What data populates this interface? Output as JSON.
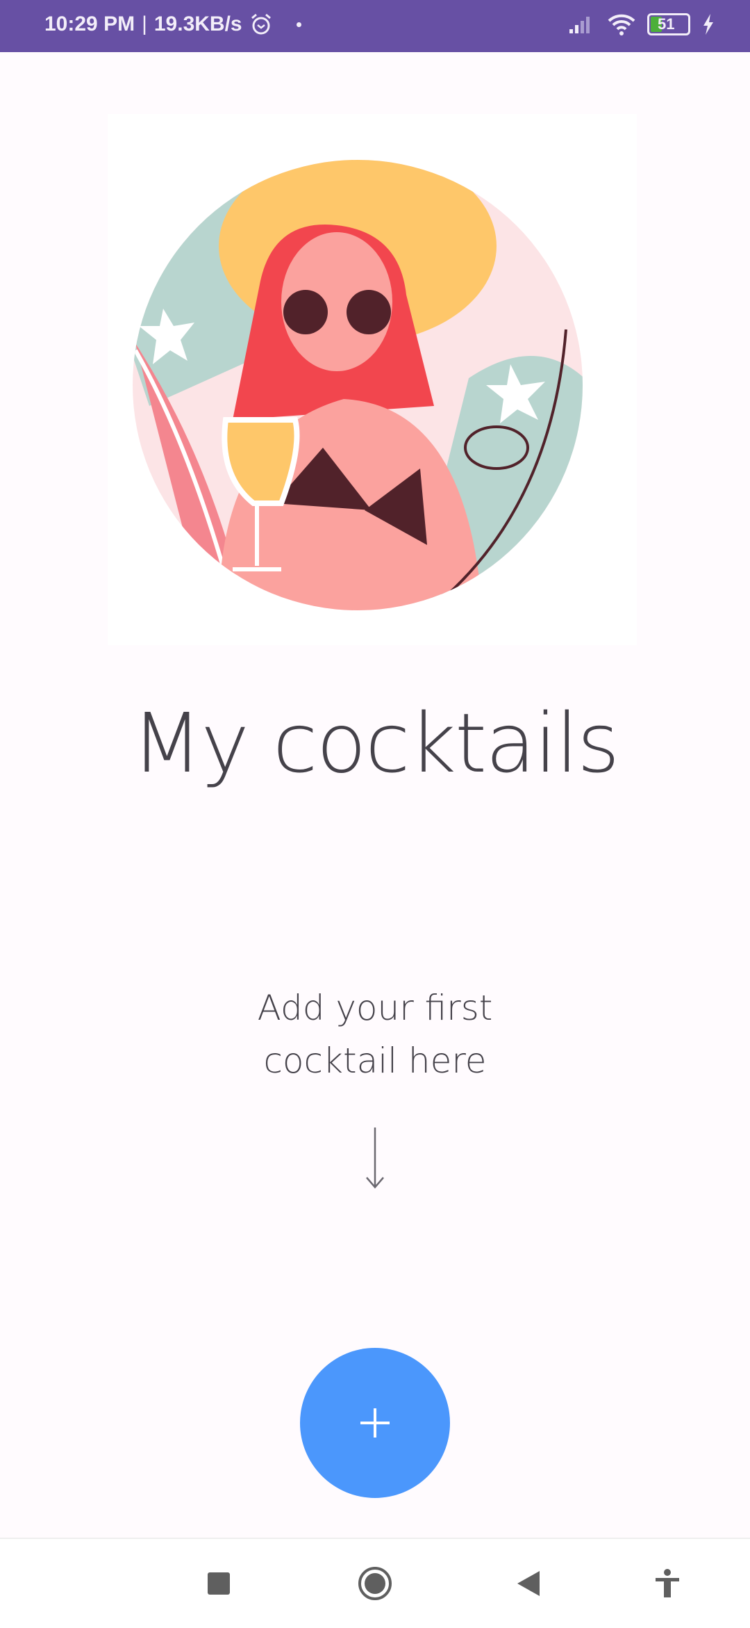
{
  "status_bar": {
    "time": "10:29 PM",
    "separator": "|",
    "net_speed": "19.3KB/s",
    "battery": "51",
    "icons": [
      "alarm-icon",
      "dot-icon",
      "signal-icon",
      "wifi-icon",
      "battery-icon",
      "charging-icon"
    ]
  },
  "main": {
    "title": "My cocktails",
    "empty_line1": "Add your first",
    "empty_line2": "cocktail here",
    "fab_icon": "plus-icon"
  },
  "colors": {
    "status_bar": "#6750a4",
    "fab": "#4b97fc",
    "background": "#fffbfe",
    "text": "#45424a"
  },
  "nav_bar": {
    "icons": [
      "recents-icon",
      "home-icon",
      "back-icon",
      "accessibility-icon"
    ]
  }
}
